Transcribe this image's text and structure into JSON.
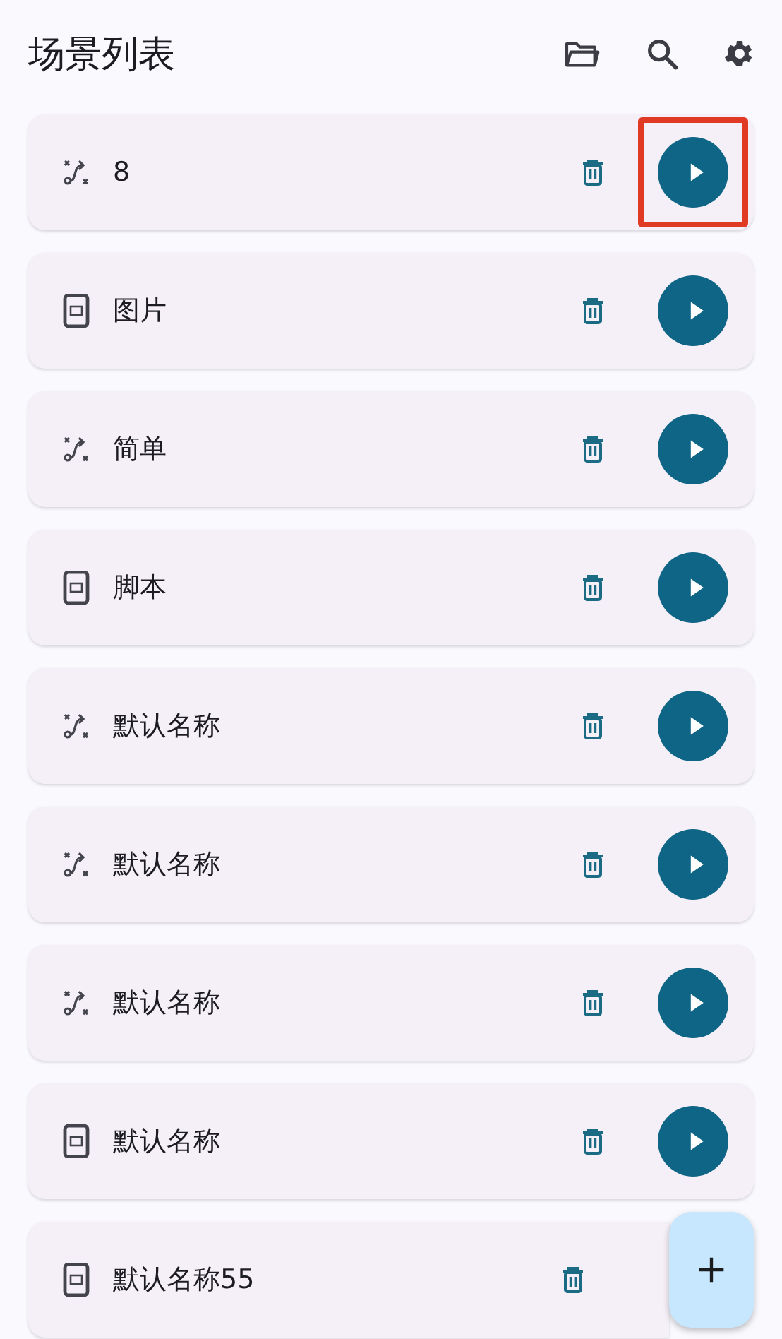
{
  "title": "场景列表",
  "scenes": [
    {
      "kind": "flow",
      "name": "8",
      "highlighted": true
    },
    {
      "kind": "phone",
      "name": "图片",
      "highlighted": false
    },
    {
      "kind": "flow",
      "name": "简单",
      "highlighted": false
    },
    {
      "kind": "phone",
      "name": "脚本",
      "highlighted": false
    },
    {
      "kind": "flow",
      "name": "默认名称",
      "highlighted": false
    },
    {
      "kind": "flow",
      "name": "默认名称",
      "highlighted": false
    },
    {
      "kind": "flow",
      "name": "默认名称",
      "highlighted": false
    },
    {
      "kind": "phone",
      "name": "默认名称",
      "highlighted": false
    },
    {
      "kind": "phone",
      "name": "默认名称55",
      "highlighted": false
    }
  ]
}
